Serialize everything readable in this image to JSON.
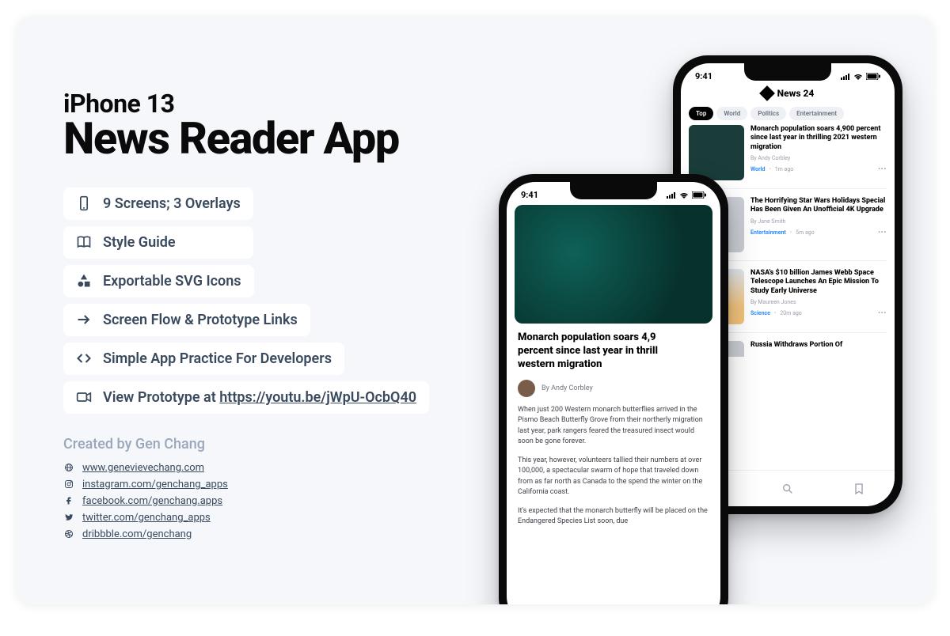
{
  "kicker": "iPhone 13",
  "title": "News Reader App",
  "features": [
    {
      "icon": "phone",
      "label": "9 Screens; 3 Overlays"
    },
    {
      "icon": "book",
      "label": "Style Guide"
    },
    {
      "icon": "shapes",
      "label": "Exportable SVG Icons"
    },
    {
      "icon": "arrow",
      "label": "Screen Flow & Prototype Links"
    },
    {
      "icon": "code",
      "label": "Simple App Practice For Developers"
    },
    {
      "icon": "video",
      "label_prefix": "View Prototype at ",
      "link": "https://youtu.be/jWpU-OcbQ40"
    }
  ],
  "credit": "Created by Gen Chang",
  "socials": [
    {
      "icon": "globe",
      "text": "www.genevievechang.com"
    },
    {
      "icon": "instagram",
      "text": "instagram.com/genchang_apps"
    },
    {
      "icon": "facebook",
      "text": "facebook.com/genchang.apps"
    },
    {
      "icon": "twitter",
      "text": "twitter.com/genchang_apps"
    },
    {
      "icon": "dribbble",
      "text": "dribbble.com/genchang"
    }
  ],
  "status_time": "9:41",
  "app": {
    "brand": "News 24",
    "chips": [
      "Top",
      "World",
      "Politics",
      "Entertainment"
    ],
    "active_chip": 0,
    "cards": [
      {
        "title": "Monarch population soars 4,900 percent since last year in thrilling 2021 western migration",
        "by": "By Andy Corbley",
        "cat": "World",
        "ago": "1m ago",
        "thumb": "teal"
      },
      {
        "title": "The Horrifying Star Wars Holidays Special Has Been Given An Unofficial 4K Upgrade",
        "by": "By Jane Smith",
        "cat": "Entertainment",
        "ago": "5m ago",
        "thumb": "grey"
      },
      {
        "title": "NASA's $10 billion James Webb Space Telescope Launches An Epic Mission To Study Early Universe",
        "by": "By Maureen Jones",
        "cat": "Science",
        "ago": "20m ago",
        "thumb": "sky"
      },
      {
        "title": "Russia Withdraws Portion Of",
        "by": "",
        "cat": "",
        "ago": "",
        "thumb": "grey"
      }
    ]
  },
  "article": {
    "title": "Monarch population soars 4,900 percent since last year in thrilling 2021 western migration",
    "title_truncated": "Monarch population soars 4,9​\npercent since last year in thrill\nwestern migration",
    "by": "By Andy Corbley",
    "p1": "When just 200 Western monarch butterflies arrived in the Pismo Beach Butterfly Grove from their northerly migration last year, park rangers feared the treasured insect would soon be gone forever.",
    "p2": "This year, however, volunteers tallied their numbers at over 100,000, a spectacular swarm of hope that traveled down from as far north as Canada to the spend the winter on the California coast.",
    "p3": "It's expected that the monarch butterfly will be placed on the Endangered Species List soon, due"
  }
}
